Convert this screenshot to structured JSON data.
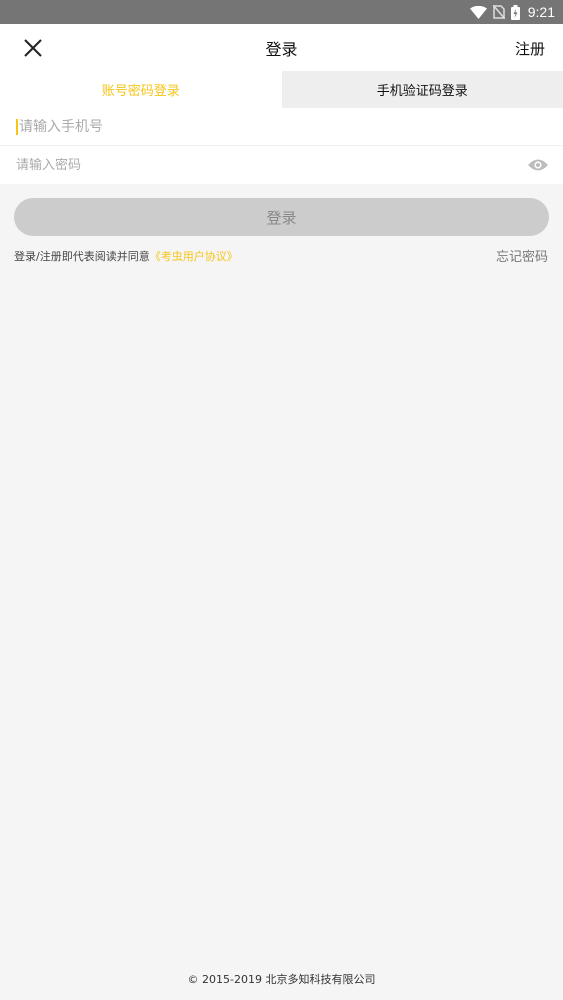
{
  "status_bar": {
    "time": "9:21",
    "icons": [
      "wifi-icon",
      "no-sim-icon",
      "battery-charging-icon"
    ]
  },
  "app_bar": {
    "title": "登录",
    "close_icon": "close-icon",
    "register_label": "注册"
  },
  "tabs": [
    {
      "label": "账号密码登录",
      "active": true
    },
    {
      "label": "手机验证码登录",
      "active": false
    }
  ],
  "form": {
    "phone_placeholder": "请输入手机号",
    "phone_value": "",
    "password_placeholder": "请输入密码",
    "password_value": "",
    "eye_icon": "eye-icon",
    "login_button": "登录"
  },
  "agreement": {
    "prefix": "登录/注册即代表阅读并同意",
    "link": "《考虫用户协议》"
  },
  "forgot_password": "忘记密码",
  "footer": "© 2015-2019 北京多知科技有限公司",
  "colors": {
    "accent": "#f5c518",
    "status_bar": "#757575",
    "background": "#f5f5f5",
    "button_disabled": "#cccccc"
  }
}
